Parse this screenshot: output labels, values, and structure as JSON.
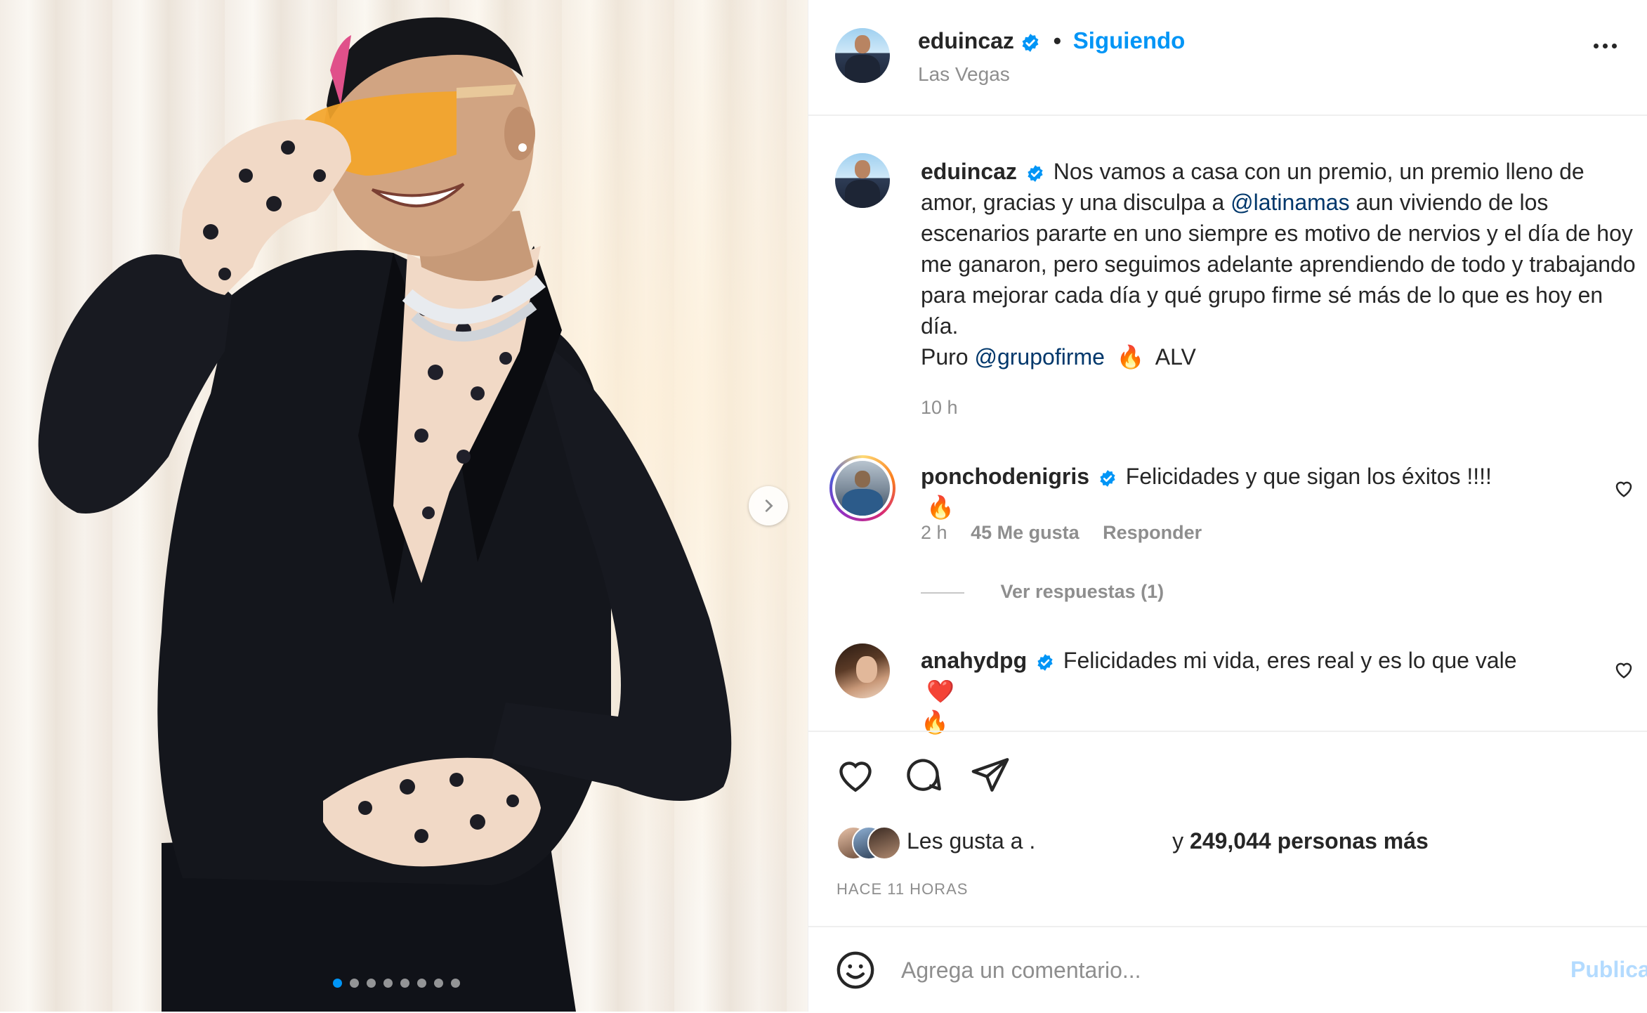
{
  "header": {
    "username": "eduincaz",
    "separator": "•",
    "follow_label": "Siguiendo",
    "location": "Las Vegas"
  },
  "caption": {
    "username": "eduincaz",
    "text_1": "Nos vamos a casa con un premio, un premio lleno de amor, gracias y una disculpa a",
    "mention_1": "@latinamas",
    "text_2": "aun viviendo de los escenarios pararte en uno siempre es motivo de nervios y el día de hoy me ganaron, pero seguimos adelante aprendiendo de todo y trabajando para mejorar cada día y qué grupo firme sé más de lo que es hoy en día.",
    "text_3": "Puro",
    "mention_2": "@grupofirme",
    "emoji_fire": "🔥",
    "text_4": "ALV",
    "time": "10 h"
  },
  "comments": [
    {
      "username": "ponchodenigris",
      "text": "Felicidades y que sigan los éxitos !!!!",
      "emoji": "🔥",
      "time": "2 h",
      "likes": "45 Me gusta",
      "reply_label": "Responder",
      "view_replies": "Ver respuestas (1)"
    },
    {
      "username": "anahydpg",
      "text": "Felicidades mi vida, eres real y es lo que vale",
      "emoji_heart": "❤️",
      "emoji_fire": "🔥"
    }
  ],
  "likes": {
    "prefix": "Les gusta a .",
    "suffix_pre": "y",
    "count_text": "249,044 personas más"
  },
  "timestamp": "HACE 11 HORAS",
  "composer": {
    "placeholder": "Agrega un comentario...",
    "publish_label": "Publicar"
  },
  "carousel": {
    "slide_count": 8,
    "active_index": 0
  },
  "colors": {
    "accent": "#0095f6",
    "link": "#00376b",
    "muted": "#8e8e8e",
    "verified": "#0095f6",
    "heart": "#ed4956"
  },
  "icons": [
    "verified-badge-icon",
    "more-options-icon",
    "chevron-right-icon",
    "heart-icon",
    "comment-icon",
    "share-icon",
    "bookmark-icon",
    "emoji-icon"
  ]
}
